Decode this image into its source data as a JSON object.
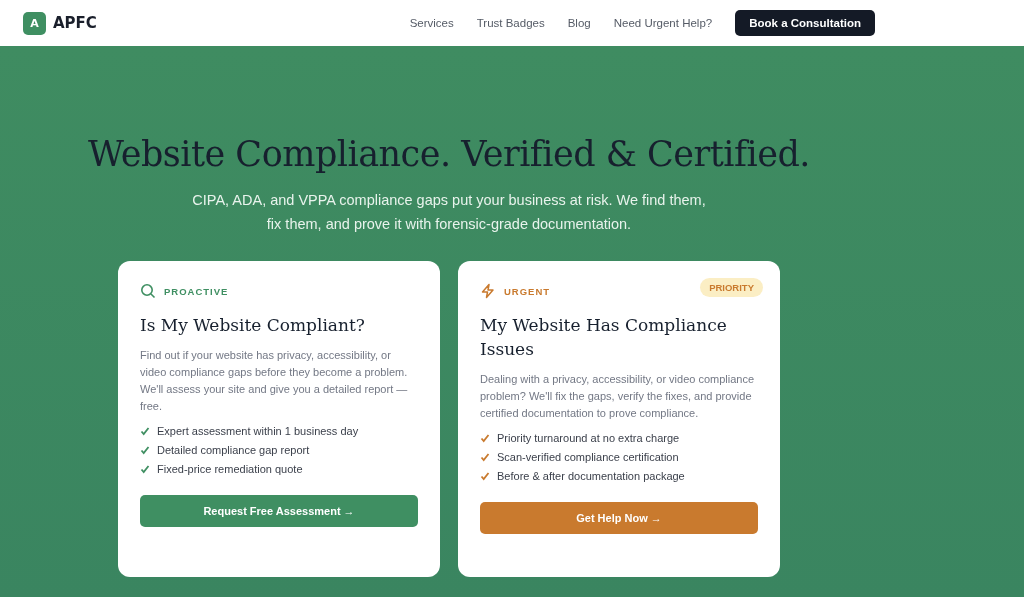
{
  "header": {
    "logo_letter": "A",
    "brand": "APFC",
    "nav": [
      "Services",
      "Trust Badges",
      "Blog",
      "Need Urgent Help?"
    ],
    "cta": "Book a Consultation"
  },
  "hero": {
    "title": "Website Compliance. Verified & Certified.",
    "subtitle": "CIPA, ADA, and VPPA compliance gaps put your business at risk. We find them, fix them, and prove it with forensic-grade documentation."
  },
  "cards": [
    {
      "kind": "proactive",
      "eyebrow": "PROACTIVE",
      "title": "Is My Website Compliant?",
      "body": "Find out if your website has privacy, accessibility, or video compliance gaps before they become a problem. We'll assess your site and give you a detailed report — free.",
      "features": [
        "Expert assessment within 1 business day",
        "Detailed compliance gap report",
        "Fixed-price remediation quote"
      ],
      "button": "Request Free Assessment →"
    },
    {
      "kind": "urgent",
      "eyebrow": "URGENT",
      "badge": "PRIORITY",
      "title": "My Website Has Compliance Issues",
      "body": "Dealing with a privacy, accessibility, or video compliance problem? We'll fix the gaps, verify the fixes, and provide certified documentation to prove compliance.",
      "features": [
        "Priority turnaround at no extra charge",
        "Scan-verified compliance certification",
        "Before & after documentation package"
      ],
      "button": "Get Help Now →"
    }
  ]
}
